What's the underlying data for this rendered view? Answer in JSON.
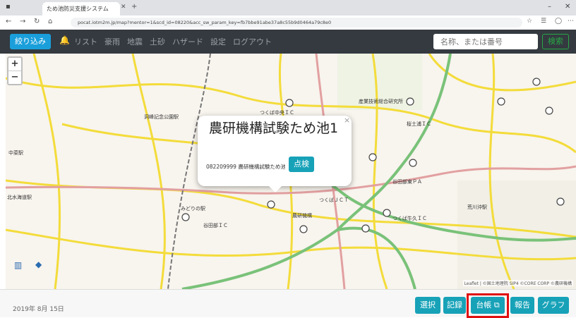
{
  "browser": {
    "tab_title": "ため池防災支援システム",
    "url": "pocat.iotm2m.jp/map?mentor=1&scd_id=08220&acc_sw_param_key=fb7bbe91abe37a8c55b9d0464a79c8e0",
    "back_icon": "arrow-left-icon",
    "forward_icon": "arrow-right-icon",
    "reload_icon": "reload-icon",
    "home_icon": "home-icon"
  },
  "nav": {
    "filter_label": "絞り込み",
    "links": [
      "リスト",
      "豪雨",
      "地震",
      "土砂",
      "ハザード",
      "設定",
      "ログアウト"
    ],
    "search_placeholder": "名称、または番号",
    "search_button": "検索"
  },
  "map": {
    "zoom_in": "+",
    "zoom_out": "−",
    "attribution": "Leaflet | ©国土地理院 SIP4 ©CORE CORP ©農研機構",
    "labels": [
      "つくば中央ＩＣ",
      "産業技術総合研究所",
      "桜土浦ＩＣ",
      "洞峰記念公園駅",
      "中菜駅",
      "北水海道駅",
      "谷田部東ＰＡ",
      "つくばＪＣＴ",
      "農研機構",
      "みどりの駅",
      "谷田部ＩＣ",
      "つくば牛久ＩＣ",
      "荒川沖駅"
    ],
    "popup": {
      "title": "農研機構試験ため池1",
      "id_text": "082209999 農研機構試験ため池1",
      "inspect_button": "点検"
    }
  },
  "footer": {
    "date": "2019年 8月 15日",
    "buttons": [
      "選択",
      "記録",
      "台帳",
      "報告",
      "グラフ"
    ]
  },
  "colors": {
    "nav_bg": "#343a40",
    "primary": "#1a9fdb",
    "info": "#17a2b8",
    "success": "#28a745",
    "highlight": "#e01010"
  }
}
